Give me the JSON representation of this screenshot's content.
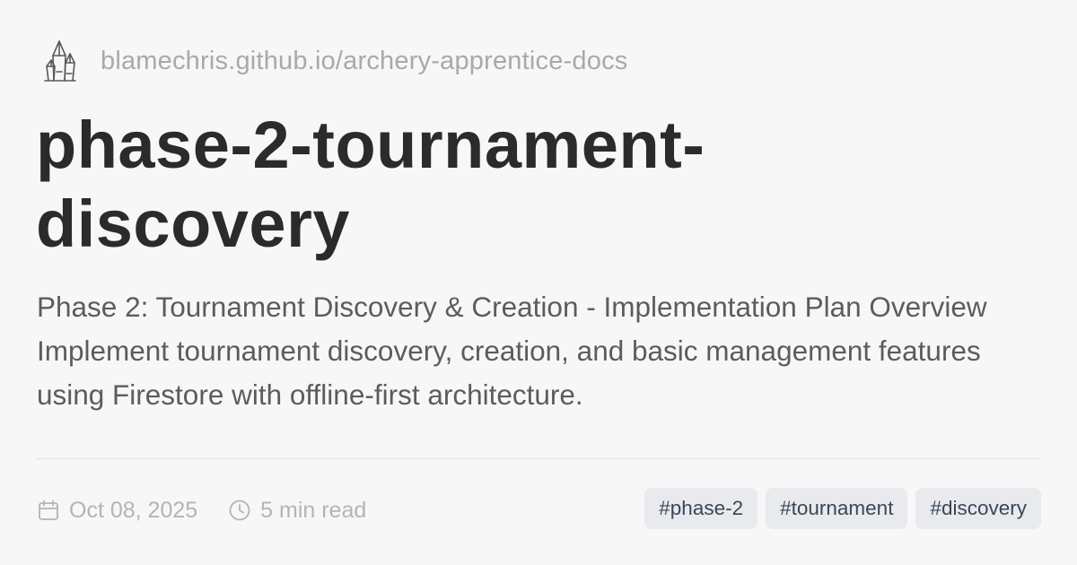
{
  "site": {
    "logo_icon": "crystal-cluster-icon",
    "url": "blamechris.github.io/archery-apprentice-docs"
  },
  "page": {
    "title": "phase-2-tournament-discovery",
    "description": "Phase 2: Tournament Discovery & Creation - Implementation Plan Overview Implement tournament discovery, creation, and basic management features using Firestore with offline-first architecture."
  },
  "meta": {
    "date_icon": "calendar-icon",
    "date": "Oct 08, 2025",
    "read_time_icon": "clock-icon",
    "read_time": "5 min read"
  },
  "tags": [
    "#phase-2",
    "#tournament",
    "#discovery"
  ],
  "colors": {
    "background": "#f7f7f8",
    "title": "#2b2b2b",
    "description": "#5c5c5e",
    "muted": "#a9a9ab",
    "tag_background": "#e8eaed",
    "tag_text": "#3a4756"
  }
}
